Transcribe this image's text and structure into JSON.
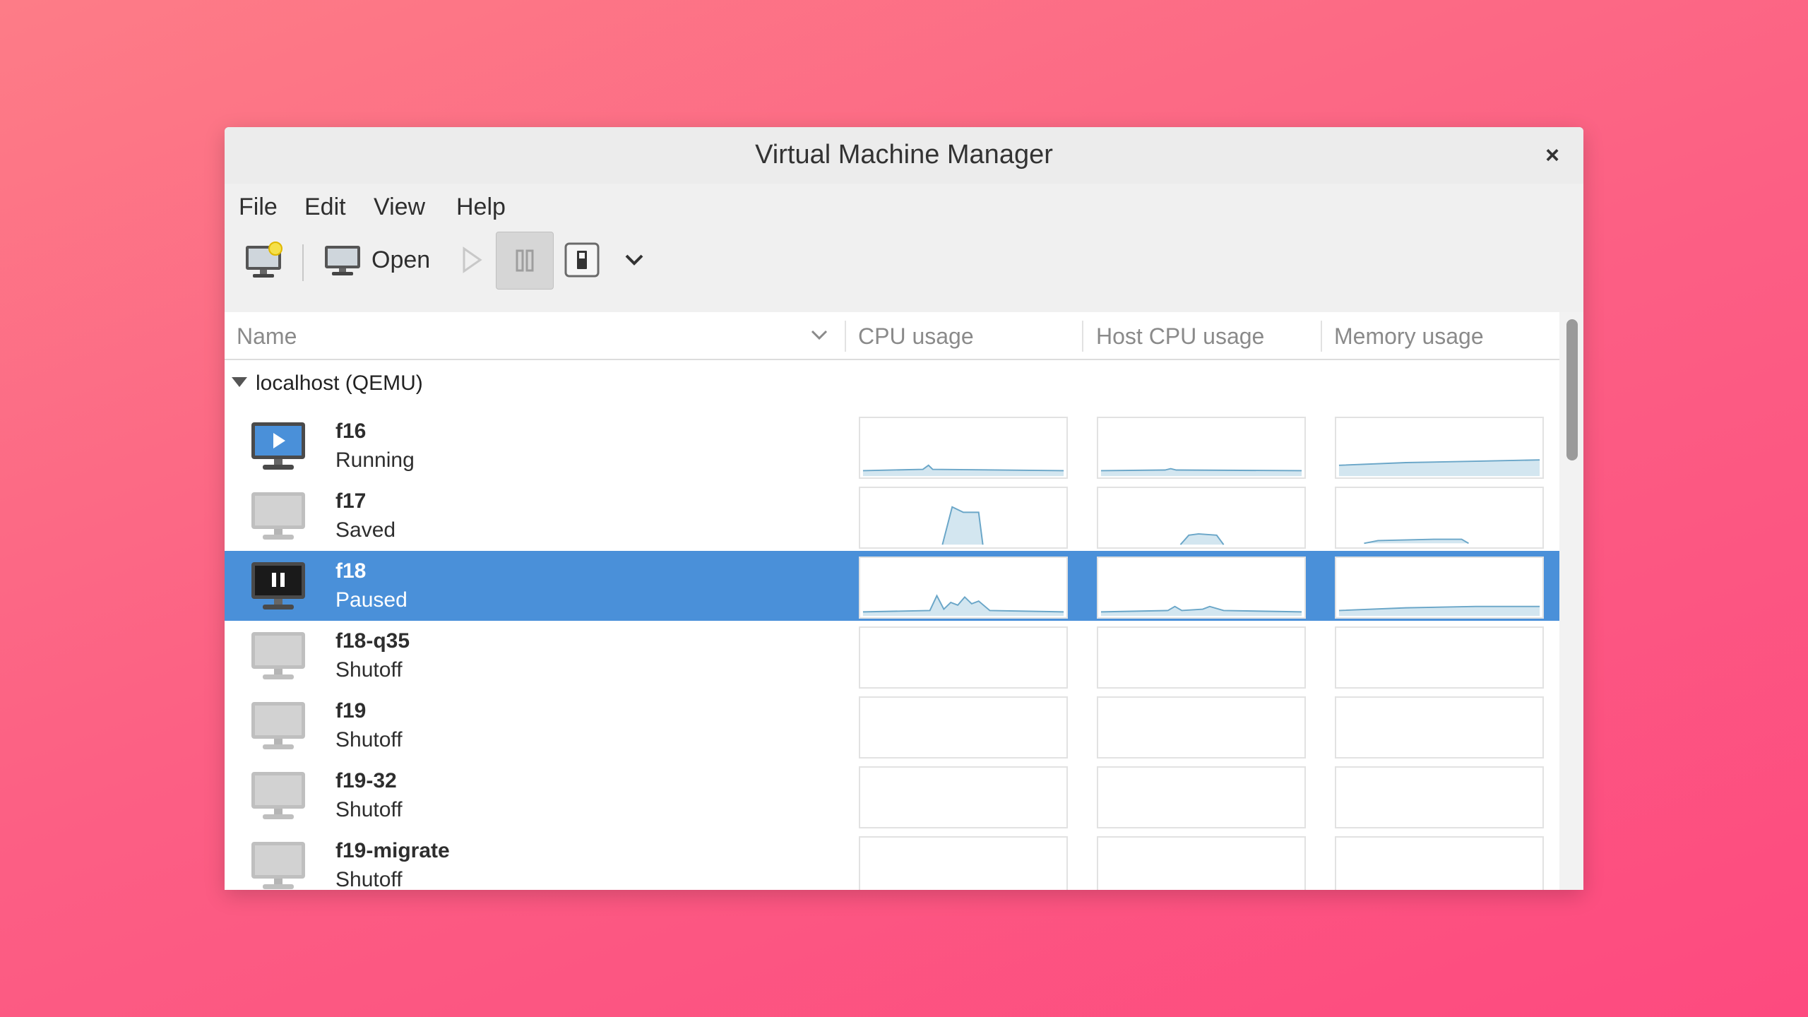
{
  "window": {
    "title": "Virtual Machine Manager"
  },
  "menu": {
    "file": "File",
    "edit": "Edit",
    "view": "View",
    "help": "Help"
  },
  "toolbar": {
    "open_label": "Open"
  },
  "columns": {
    "name": "Name",
    "cpu": "CPU usage",
    "host_cpu": "Host CPU usage",
    "memory": "Memory usage"
  },
  "group": {
    "label": "localhost (QEMU)"
  },
  "colors": {
    "selection": "#4a90d9",
    "graph_line": "#6aa6c8",
    "graph_fill": "#d3e6f0"
  },
  "vms": [
    {
      "name": "f16",
      "status": "Running",
      "state_icon": "play-icon"
    },
    {
      "name": "f17",
      "status": "Saved",
      "state_icon": "none"
    },
    {
      "name": "f18",
      "status": "Paused",
      "state_icon": "pause-icon",
      "selected": true
    },
    {
      "name": "f18-q35",
      "status": "Shutoff",
      "state_icon": "none"
    },
    {
      "name": "f19",
      "status": "Shutoff",
      "state_icon": "none"
    },
    {
      "name": "f19-32",
      "status": "Shutoff",
      "state_icon": "none"
    },
    {
      "name": "f19-migrate",
      "status": "Shutoff",
      "state_icon": "none"
    }
  ]
}
